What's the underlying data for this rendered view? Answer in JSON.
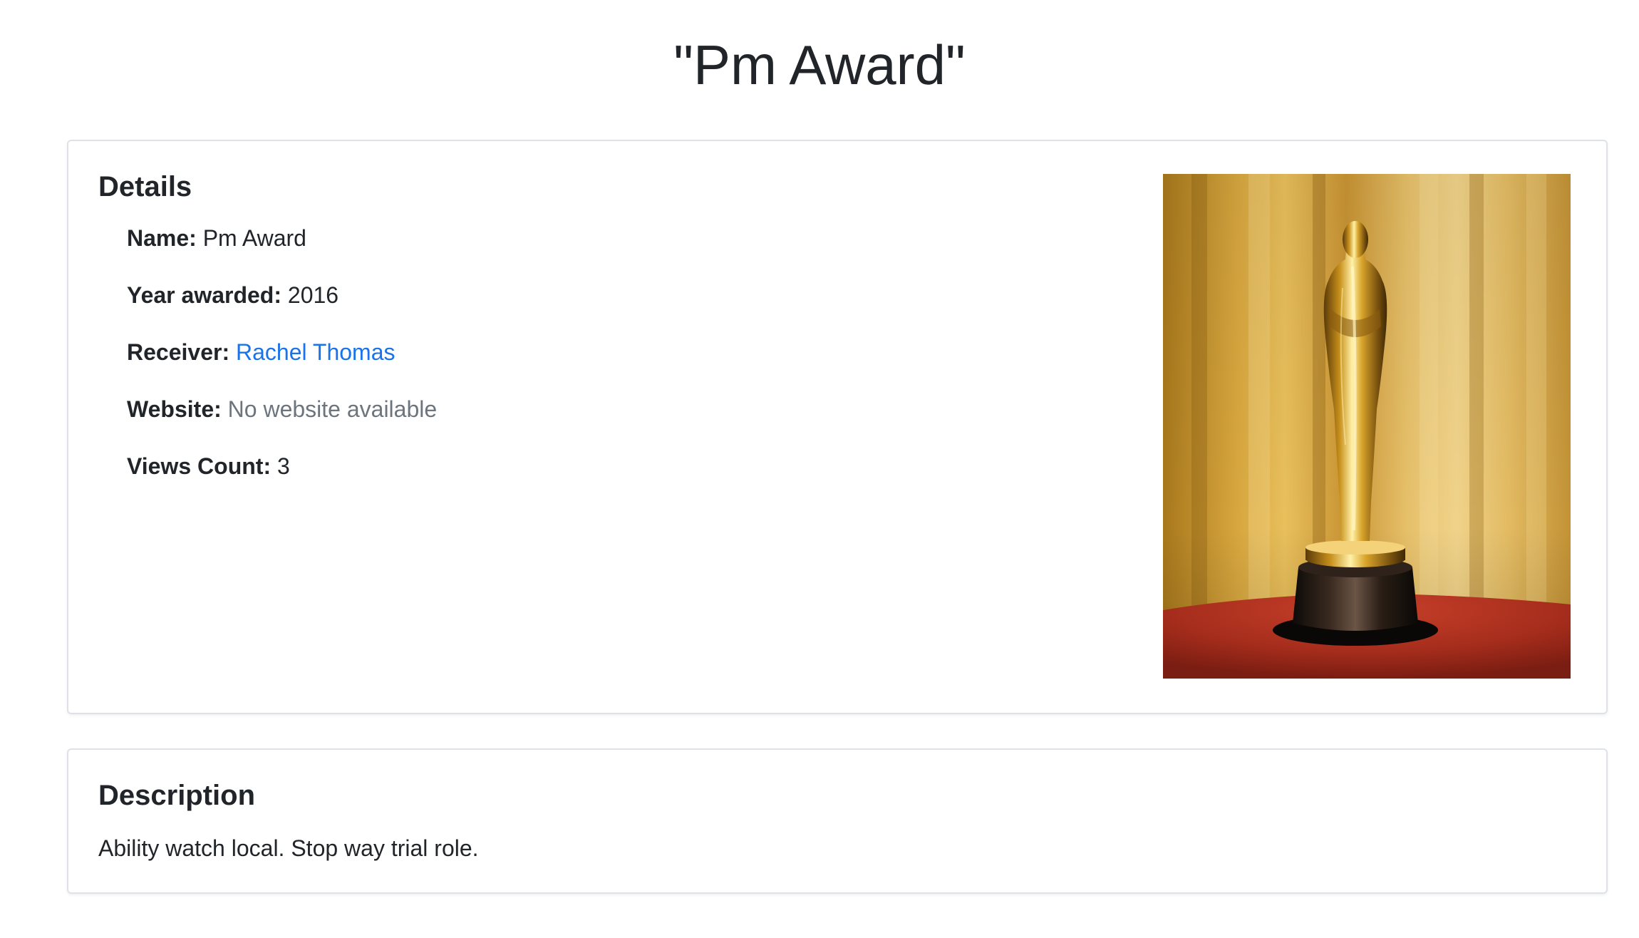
{
  "page": {
    "title": "\"Pm Award\""
  },
  "details": {
    "heading": "Details",
    "items": [
      {
        "label": "Name:",
        "value": "Pm Award"
      },
      {
        "label": "Year awarded:",
        "value": "2016"
      },
      {
        "label": "Receiver:",
        "value": "Rachel Thomas"
      },
      {
        "label": "Website:",
        "value": "No website available"
      },
      {
        "label": "Views Count:",
        "value": "3"
      }
    ],
    "image": {
      "icon": "award-statuette-image"
    }
  },
  "description": {
    "heading": "Description",
    "text": "Ability watch local. Stop way trial role."
  },
  "colors": {
    "text": "#212529",
    "link": "#1a73e8",
    "muted": "#6c757d",
    "border": "#dee2e6"
  }
}
